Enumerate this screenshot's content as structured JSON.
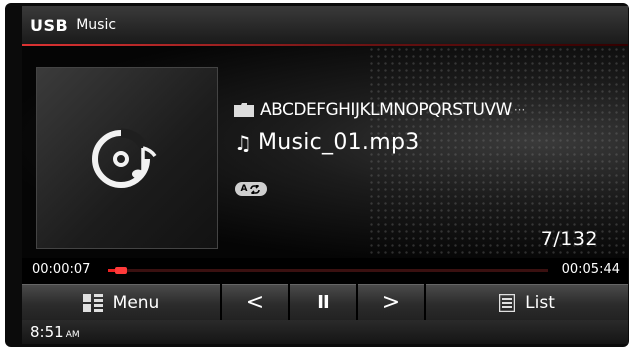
{
  "header": {
    "source": "USB",
    "mode": "Music"
  },
  "track": {
    "folder": "ABCDEFGHIJKLMNOPQRSTUVW",
    "folder_overflow": "···",
    "filename": "Music_01.mp3",
    "repeat_badge_letter": "A",
    "track_counter": "7/132"
  },
  "progress": {
    "elapsed": "00:00:07",
    "total": "00:05:44",
    "fraction": 0.02
  },
  "controls": {
    "menu_label": "Menu",
    "prev_glyph": "<",
    "pause_glyph": "II",
    "next_glyph": ">",
    "list_label": "List"
  },
  "status": {
    "time": "8:51",
    "ampm": "AM"
  },
  "icons": {
    "album": "music-disc-icon",
    "folder": "folder-icon",
    "note": "music-note-icon",
    "menu": "grid-menu-icon",
    "list": "list-icon",
    "repeat": "repeat-icon"
  },
  "colors": {
    "accent": "#e22222",
    "text": "#ffffff",
    "background": "#000000"
  }
}
